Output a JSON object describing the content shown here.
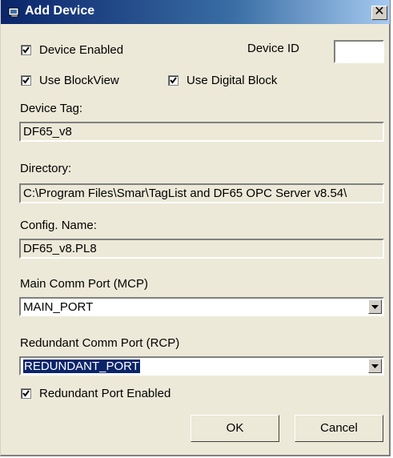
{
  "window": {
    "title": "Add Device",
    "close_glyph": "✕"
  },
  "device_enabled": {
    "label": "Device Enabled",
    "checked": true
  },
  "device_id": {
    "label": "Device ID",
    "value": ""
  },
  "use_blockview": {
    "label": "Use BlockView",
    "checked": true
  },
  "use_digital_block": {
    "label": "Use Digital Block",
    "checked": true
  },
  "device_tag": {
    "label": "Device Tag:",
    "value": "DF65_v8"
  },
  "directory": {
    "label": "Directory:",
    "value": "C:\\Program Files\\Smar\\TagList and DF65 OPC Server v8.54\\"
  },
  "config_name": {
    "label": "Config. Name:",
    "value": "DF65_v8.PL8"
  },
  "main_comm_port": {
    "label": "Main Comm Port (MCP)",
    "value": "MAIN_PORT"
  },
  "redundant_comm_port": {
    "label": "Redundant Comm Port (RCP)",
    "value": "REDUNDANT_PORT"
  },
  "redundant_port_enabled": {
    "label": "Redundant Port Enabled",
    "checked": true
  },
  "buttons": {
    "ok": "OK",
    "cancel": "Cancel"
  },
  "icons": {
    "title": "device-icon",
    "checkbox": "checkmark-icon",
    "dropdown": "chevron-down-icon"
  },
  "colors": {
    "titlebar_start": "#0a246a",
    "titlebar_end": "#a6caf0",
    "dialog_bg": "#ece9d8",
    "selection": "#0a246a"
  }
}
